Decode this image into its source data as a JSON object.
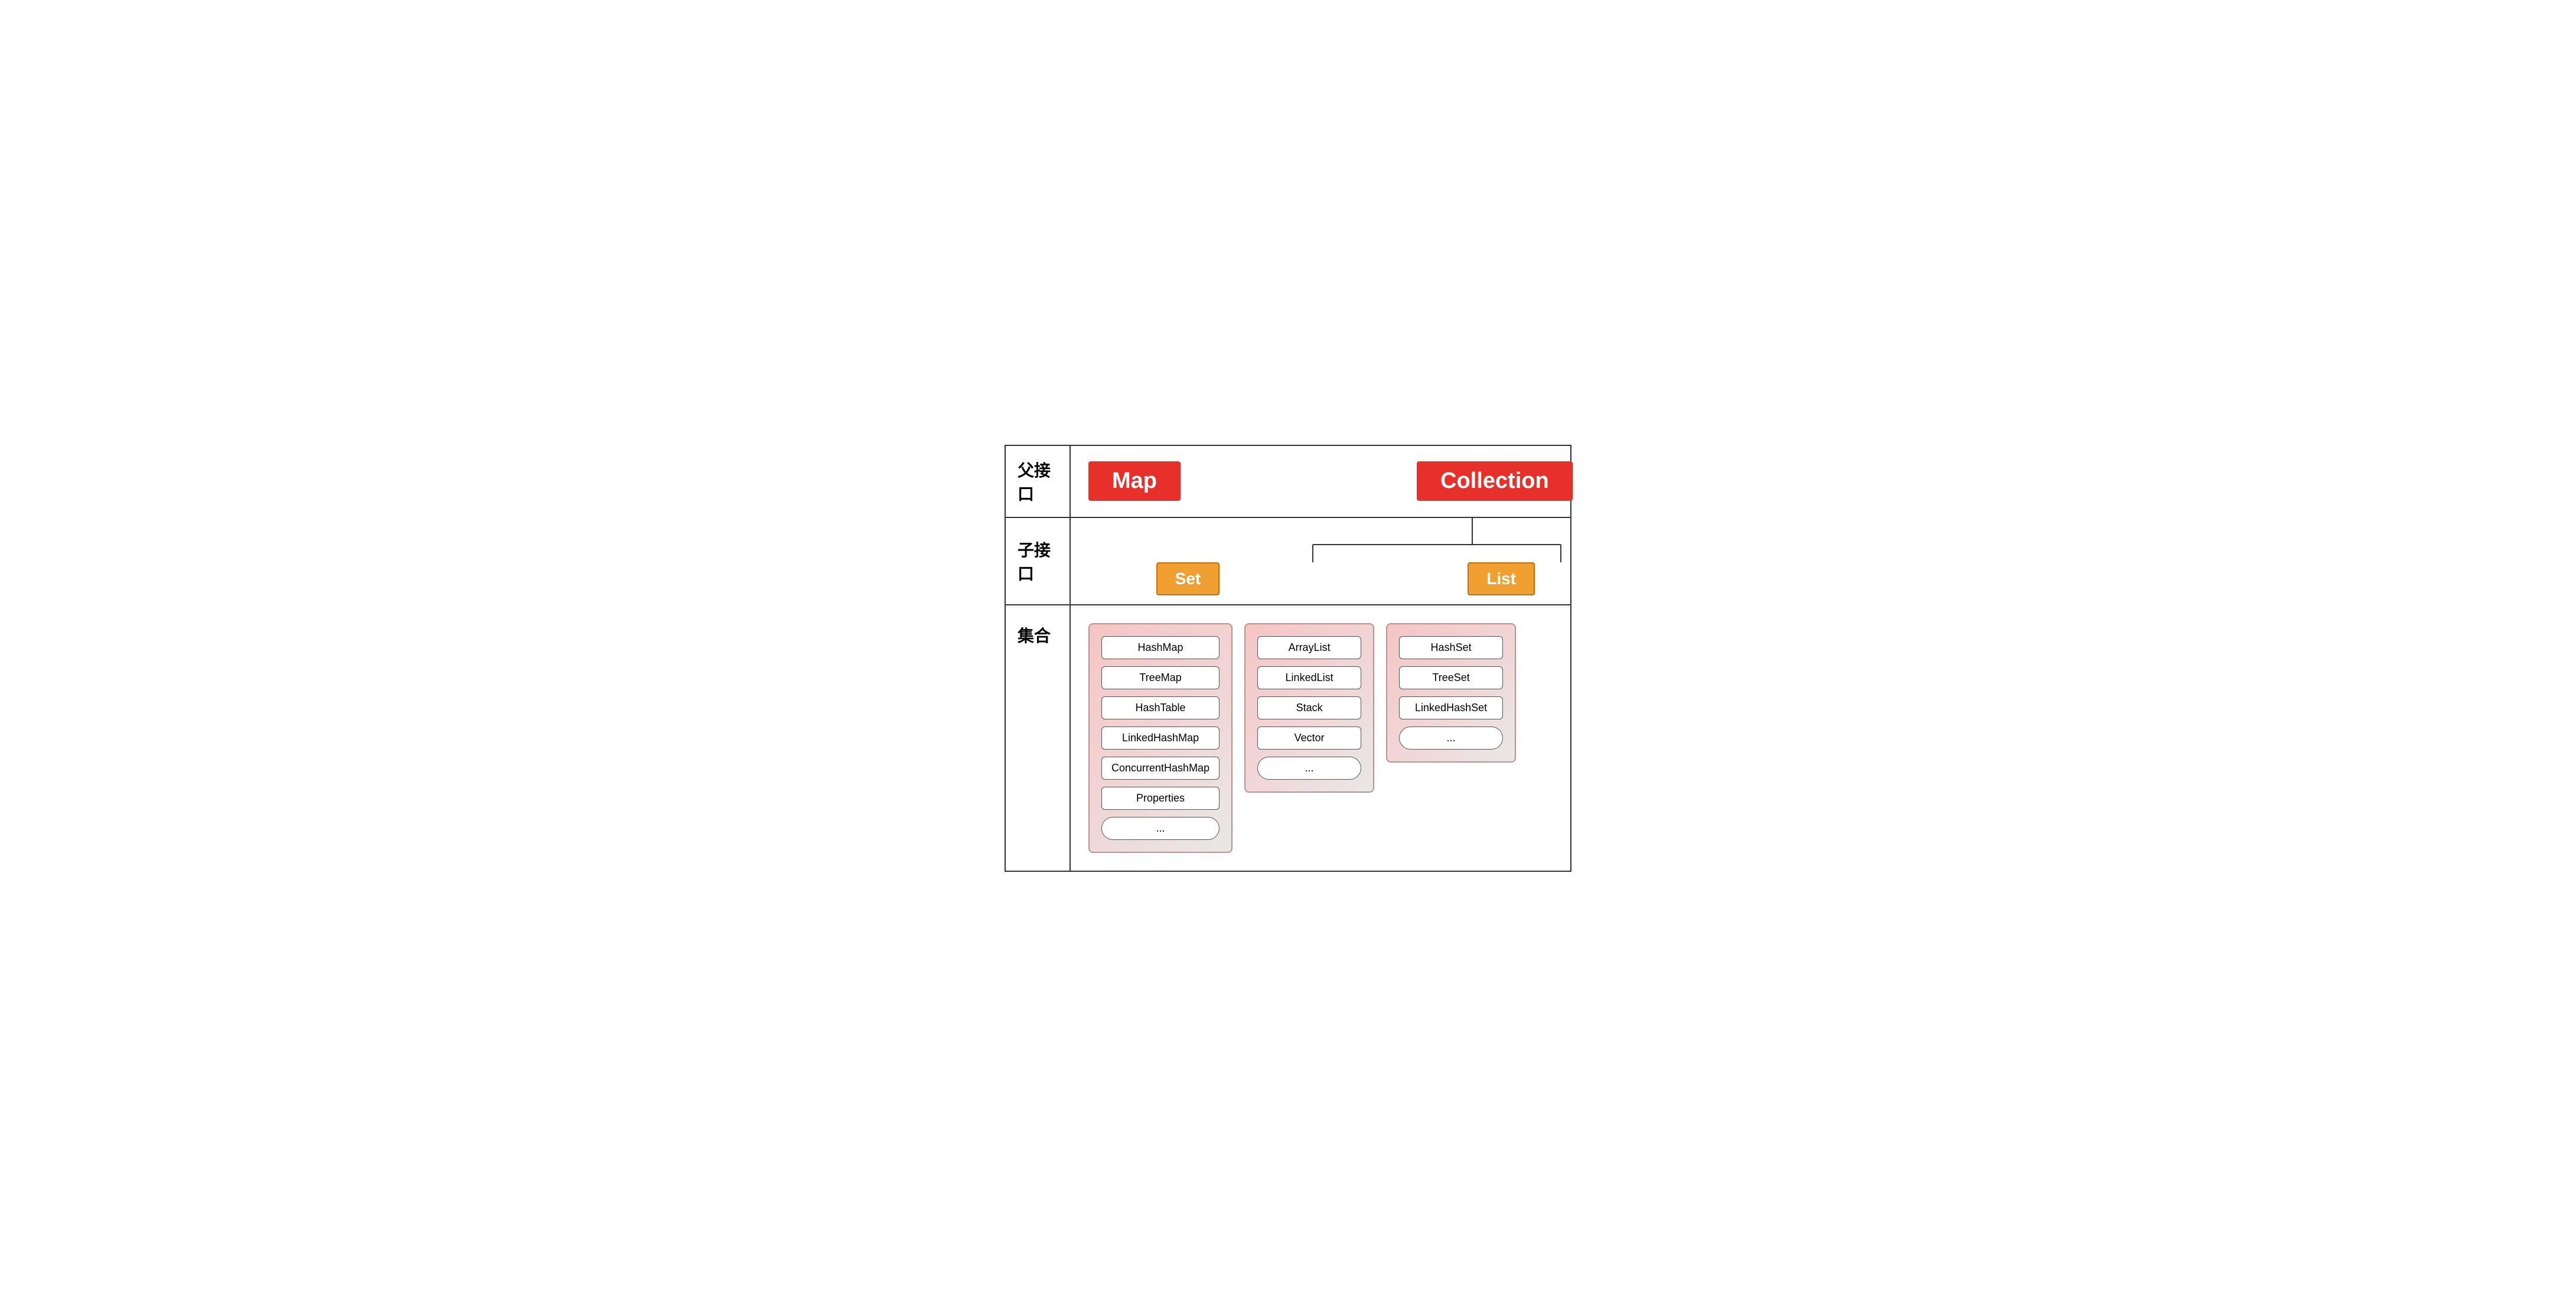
{
  "diagram": {
    "rows": {
      "parent": {
        "label": "父接口",
        "map_box": "Map",
        "collection_box": "Collection"
      },
      "sub": {
        "label": "子接口",
        "set_box": "Set",
        "list_box": "List"
      },
      "collection": {
        "label": "集合",
        "map_group": [
          "HashMap",
          "TreeMap",
          "HashTable",
          "LinkedHashMap",
          "ConcurrentHashMap",
          "Properties",
          "..."
        ],
        "list_group": [
          "ArrayList",
          "LinkedList",
          "Stack",
          "Vector",
          "..."
        ],
        "set_group": [
          "HashSet",
          "TreeSet",
          "LinkedHashSet",
          "..."
        ]
      }
    }
  }
}
